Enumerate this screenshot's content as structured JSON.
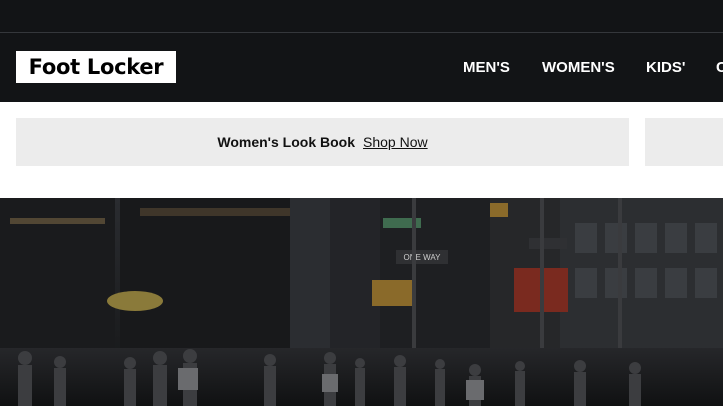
{
  "brand": {
    "logo_text": "Foot Locker"
  },
  "nav": {
    "items": [
      {
        "label": "MEN'S"
      },
      {
        "label": "WOMEN'S"
      },
      {
        "label": "KIDS'"
      },
      {
        "label": "C"
      }
    ]
  },
  "promo": {
    "title": "Women's Look Book",
    "link_label": "Shop Now"
  },
  "hero": {
    "image_subject": "city-street-crowd-photo",
    "sign_text": [
      "ONE WAY"
    ]
  },
  "colors": {
    "header_bg": "#121416",
    "promo_bg": "#ececec",
    "hero_bg": "#1c1d1f"
  }
}
